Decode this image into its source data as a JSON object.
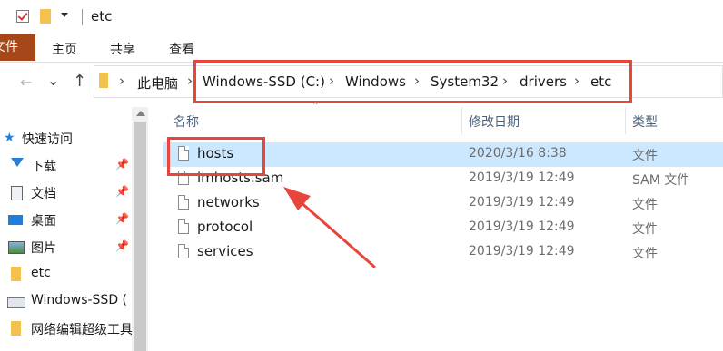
{
  "window": {
    "title": "etc"
  },
  "ribbon": {
    "file_tab": "文件",
    "tabs": [
      "主页",
      "共享",
      "查看"
    ]
  },
  "address": {
    "back_icon": "←",
    "forward_icon": "→",
    "recent_icon": "⌄",
    "up_icon": "↑",
    "separator": "›",
    "crumbs": [
      "此电脑",
      "Windows-SSD (C:)",
      "Windows",
      "System32",
      "drivers",
      "etc"
    ]
  },
  "nav": {
    "items": [
      {
        "label": "快速访问",
        "icon": "star-icon"
      },
      {
        "label": "下载",
        "icon": "download-icon",
        "pinned": true
      },
      {
        "label": "文档",
        "icon": "document-icon",
        "pinned": true
      },
      {
        "label": "桌面",
        "icon": "desktop-icon",
        "pinned": true
      },
      {
        "label": "图片",
        "icon": "picture-icon",
        "pinned": true
      },
      {
        "label": "etc",
        "icon": "folder-icon"
      },
      {
        "label": "Windows-SSD (",
        "icon": "drive-icon"
      },
      {
        "label": "网络编辑超级工具",
        "icon": "folder-icon"
      }
    ],
    "pin_glyph": "📌"
  },
  "columns": {
    "name": "名称",
    "modified": "修改日期",
    "type": "类型"
  },
  "files": [
    {
      "name": "hosts",
      "modified": "2020/3/16 8:38",
      "type": "文件",
      "selected": true
    },
    {
      "name": "lmhosts.sam",
      "modified": "2019/3/19 12:49",
      "type": "SAM 文件"
    },
    {
      "name": "networks",
      "modified": "2019/3/19 12:49",
      "type": "文件"
    },
    {
      "name": "protocol",
      "modified": "2019/3/19 12:49",
      "type": "文件"
    },
    {
      "name": "services",
      "modified": "2019/3/19 12:49",
      "type": "文件"
    }
  ],
  "colors": {
    "annotation": "#e8453c",
    "file_tab": "#a6471a",
    "selection": "#cce8ff"
  }
}
